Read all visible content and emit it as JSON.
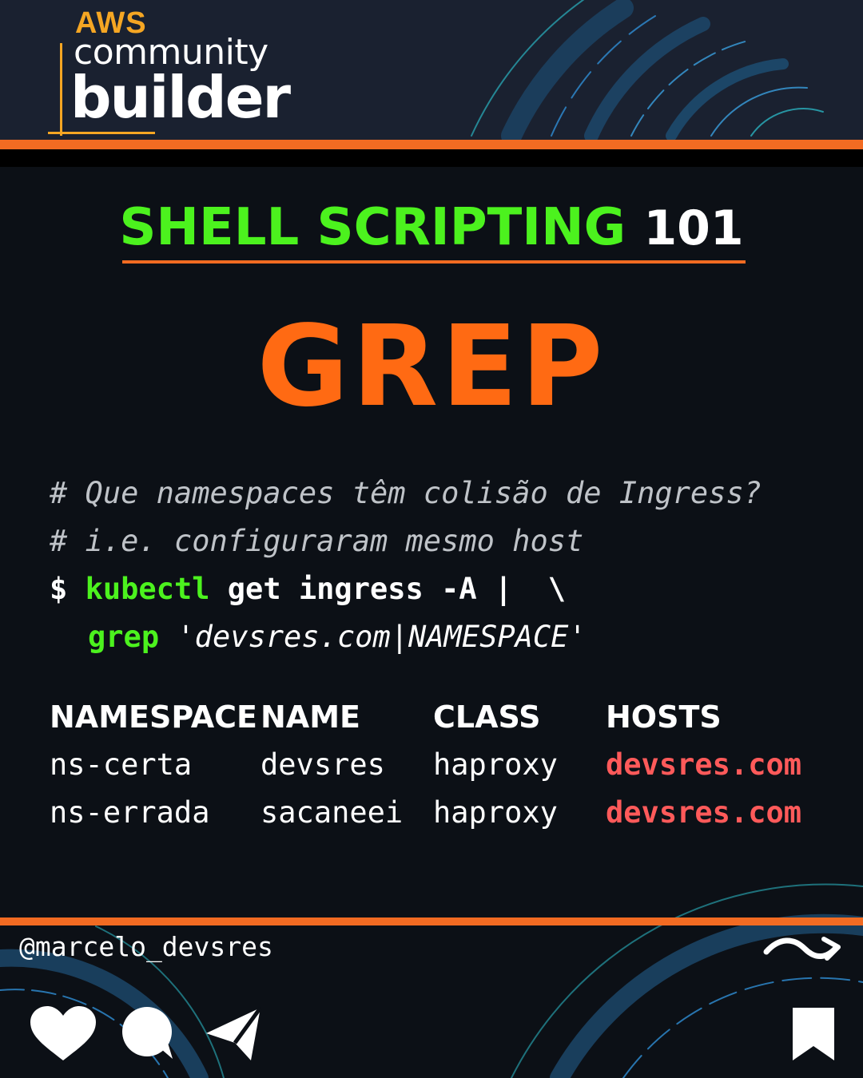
{
  "logo": {
    "aws": "AWS",
    "community": "community",
    "builder": "builder"
  },
  "title": {
    "part1": "SHELL",
    "part2": "SCRIPTING",
    "part3": "101"
  },
  "headline": "GREP",
  "code": {
    "comment1": "# Que namespaces têm colisão de Ingress?",
    "comment2": "# i.e. configuraram mesmo host",
    "prompt": "$",
    "cmd": "kubectl",
    "args": "get ingress -A |  \\",
    "grep": "grep",
    "pattern": "'devsres.com|NAMESPACE'"
  },
  "table": {
    "headers": [
      "NAMESPACE",
      "NAME",
      "CLASS",
      "HOSTS"
    ],
    "rows": [
      [
        "ns-certa",
        "devsres",
        "haproxy",
        "devsres.com"
      ],
      [
        "ns-errada",
        "sacaneei",
        "haproxy",
        "devsres.com"
      ]
    ]
  },
  "footer": {
    "handle": "@marcelo_devsres"
  },
  "icons": [
    "heart-icon",
    "comment-icon",
    "send-icon",
    "bookmark-icon",
    "arrow-icon"
  ],
  "colors": {
    "orange": "#f26b22",
    "green": "#4cf21e",
    "grep": "#ff6a13",
    "host": "#ff5a5a",
    "aws": "#f5a623"
  }
}
